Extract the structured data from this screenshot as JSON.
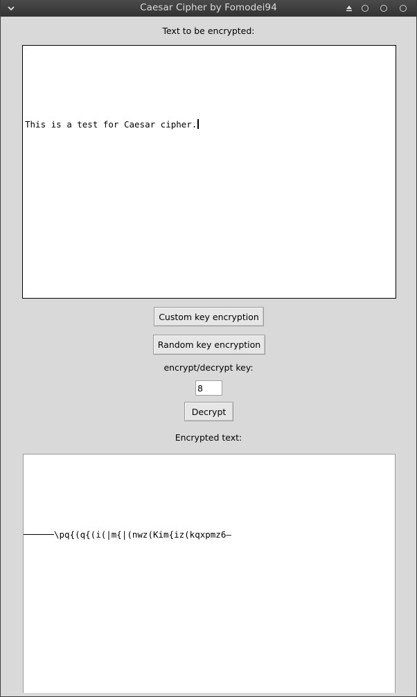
{
  "window": {
    "title": "Caesar Cipher by Fomodei94"
  },
  "input_section": {
    "label": "Text to be encrypted:",
    "text": "This is a test for Caesar cipher."
  },
  "buttons": {
    "custom_key": "Custom key encryption",
    "random_key": "Random key encryption",
    "decrypt": "Decrypt"
  },
  "key_section": {
    "label": "encrypt/decrypt key:",
    "value": "8"
  },
  "output_section": {
    "label": "Encrypted text:",
    "text": "\\pq{(q{(i(|m{|(nwz(Kim{iz(kqxpmz6—"
  },
  "icons": {
    "menu": "chevron-down-icon",
    "shade": "shade-up-icon",
    "minimize": "circle-icon",
    "maximize": "circle-icon",
    "close": "circle-icon"
  }
}
